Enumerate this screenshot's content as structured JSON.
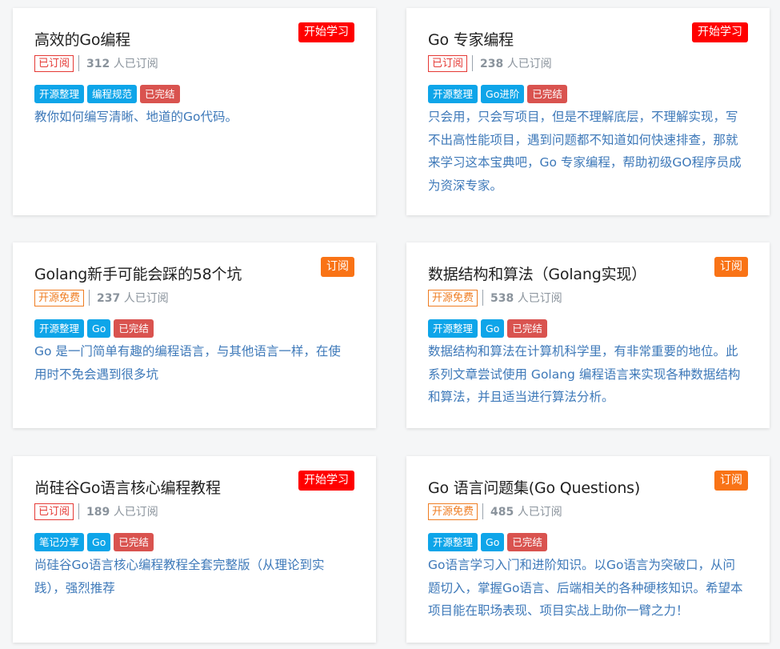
{
  "courses": [
    {
      "title": "高效的Go编程",
      "action_label": "开始学习",
      "status_label": "已订阅",
      "subscribers": "312",
      "subscribers_suffix": " 人已订阅",
      "tags": [
        "开源整理",
        "编程规范",
        "已完结"
      ],
      "description": "教你如何编写清晰、地道的Go代码。"
    },
    {
      "title": "Go 专家编程",
      "action_label": "开始学习",
      "status_label": "已订阅",
      "subscribers": "238",
      "subscribers_suffix": " 人已订阅",
      "tags": [
        "开源整理",
        "Go进阶",
        "已完结"
      ],
      "description": "只会用，只会写项目，但是不理解底层，不理解实现，写不出高性能项目，遇到问题都不知道如何快速排查，那就来学习这本宝典吧，Go 专家编程，帮助初级GO程序员成为资深专家。"
    },
    {
      "title": "Golang新手可能会踩的58个坑",
      "action_label": "订阅",
      "status_label": "开源免费",
      "subscribers": "237",
      "subscribers_suffix": " 人已订阅",
      "tags": [
        "开源整理",
        "Go",
        "已完结"
      ],
      "description": "Go 是一门简单有趣的编程语言，与其他语言一样，在使用时不免会遇到很多坑"
    },
    {
      "title": "数据结构和算法（Golang实现）",
      "action_label": "订阅",
      "status_label": "开源免费",
      "subscribers": "538",
      "subscribers_suffix": " 人已订阅",
      "tags": [
        "开源整理",
        "Go",
        "已完结"
      ],
      "description": "数据结构和算法在计算机科学里，有非常重要的地位。此系列文章尝试使用 Golang 编程语言来实现各种数据结构和算法，并且适当进行算法分析。"
    },
    {
      "title": "尚硅谷Go语言核心编程教程",
      "action_label": "开始学习",
      "status_label": "已订阅",
      "subscribers": "189",
      "subscribers_suffix": " 人已订阅",
      "tags": [
        "笔记分享",
        "Go",
        "已完结"
      ],
      "description": "尚硅谷Go语言核心编程教程全套完整版（从理论到实践），强烈推荐"
    },
    {
      "title": "Go 语言问题集(Go Questions)",
      "action_label": "订阅",
      "status_label": "开源免费",
      "subscribers": "485",
      "subscribers_suffix": " 人已订阅",
      "tags": [
        "开源整理",
        "Go",
        "已完结"
      ],
      "description": "Go语言学习入门和进阶知识。以Go语言为突破口，从问题切入，掌握Go语言、后端相关的各种硬核知识。希望本项目能在职场表现、项目实战上助你一臂之力！"
    }
  ],
  "colors": {
    "start_button": "#ff0000",
    "subscribe_button": "#f97316",
    "subscribed_badge": "#e53935",
    "free_badge": "#ef7d22",
    "tag_blue": "#0ea5e9",
    "tag_completed": "#d9534f",
    "description_text": "#3e79b9"
  }
}
